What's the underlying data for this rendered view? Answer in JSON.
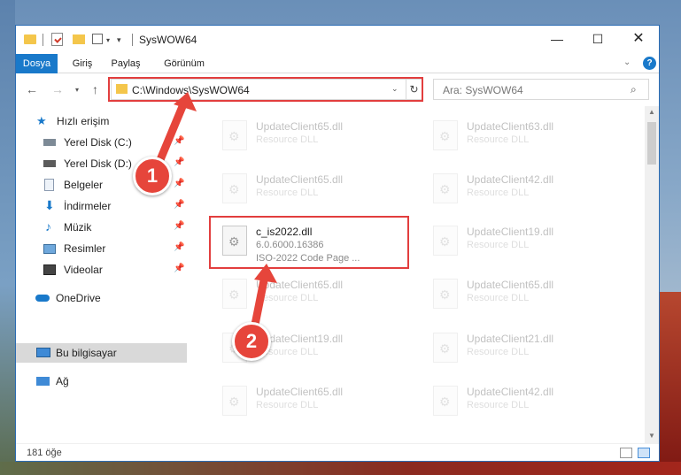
{
  "window": {
    "title": "SysWOW64"
  },
  "ribbon": {
    "tabs": [
      "Dosya",
      "Giriş",
      "Paylaş",
      "Görünüm"
    ],
    "help": "?"
  },
  "address": {
    "path": "C:\\Windows\\SysWOW64",
    "search_placeholder": "Ara: SysWOW64"
  },
  "sidebar": {
    "items": [
      {
        "label": "Hızlı erişim",
        "icon": "star-icon"
      },
      {
        "label": "Yerel Disk (C:)",
        "icon": "drive-icon",
        "pinned": true
      },
      {
        "label": "Yerel Disk (D:)",
        "icon": "drive-icon",
        "pinned": true
      },
      {
        "label": "Belgeler",
        "icon": "documents-icon",
        "pinned": true
      },
      {
        "label": "İndirmeler",
        "icon": "download-icon",
        "pinned": true
      },
      {
        "label": "Müzik",
        "icon": "music-icon",
        "pinned": true
      },
      {
        "label": "Resimler",
        "icon": "pictures-icon",
        "pinned": true
      },
      {
        "label": "Videolar",
        "icon": "videos-icon",
        "pinned": true
      },
      {
        "label": "OneDrive",
        "icon": "cloud-icon"
      },
      {
        "label": "Bu bilgisayar",
        "icon": "computer-icon",
        "selected": true
      },
      {
        "label": "Ağ",
        "icon": "network-icon"
      }
    ]
  },
  "files": {
    "left": [
      {
        "name": "UpdateClient65.dll",
        "desc": "Resource DLL"
      },
      {
        "name": "UpdateClient65.dll",
        "desc": "Resource DLL"
      },
      {
        "name": "c_is2022.dll",
        "desc": "6.0.6000.16386",
        "desc2": "ISO-2022 Code Page ..."
      },
      {
        "name": "UpdateClient65.dll",
        "desc": "Resource DLL"
      },
      {
        "name": "UpdateClient19.dll",
        "desc": "Resource DLL"
      },
      {
        "name": "UpdateClient65.dll",
        "desc": "Resource DLL"
      }
    ],
    "right": [
      {
        "name": "UpdateClient63.dll",
        "desc": "Resource DLL"
      },
      {
        "name": "UpdateClient42.dll",
        "desc": "Resource DLL"
      },
      {
        "name": "UpdateClient19.dll",
        "desc": "Resource DLL"
      },
      {
        "name": "UpdateClient65.dll",
        "desc": "Resource DLL"
      },
      {
        "name": "UpdateClient21.dll",
        "desc": "Resource DLL"
      },
      {
        "name": "UpdateClient42.dll",
        "desc": "Resource DLL"
      }
    ]
  },
  "status": {
    "count": "181 öğe"
  },
  "annotations": {
    "step1": "1",
    "step2": "2",
    "color": "#e6453b"
  }
}
